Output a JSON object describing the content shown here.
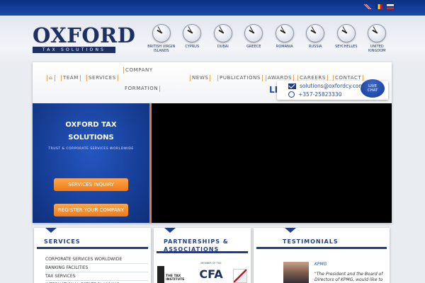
{
  "brand": {
    "name": "OXFORD",
    "tagline": "TAX SOLUTIONS"
  },
  "languages": [
    {
      "flag": "uk-flag-icon"
    },
    {
      "flag": "romania-flag-icon"
    },
    {
      "flag": "russia-flag-icon"
    }
  ],
  "clocks": [
    {
      "label": "British Virgin Islands",
      "hour_angle": 300,
      "minute_angle": 330
    },
    {
      "label": "Cyprus",
      "hour_angle": 300,
      "minute_angle": 330
    },
    {
      "label": "Dubai",
      "hour_angle": 300,
      "minute_angle": 330
    },
    {
      "label": "Greece",
      "hour_angle": 300,
      "minute_angle": 330
    },
    {
      "label": "Romania",
      "hour_angle": 300,
      "minute_angle": 330
    },
    {
      "label": "Russia",
      "hour_angle": 300,
      "minute_angle": 330
    },
    {
      "label": "Seychelles",
      "hour_angle": 300,
      "minute_angle": 330
    },
    {
      "label": "United Kingdom",
      "hour_angle": 300,
      "minute_angle": 330
    }
  ],
  "nav": {
    "home": "⌂",
    "team": "Team",
    "services": "Services",
    "company_formation_line1": "Company",
    "company_formation_line2": "Formation",
    "news": "News",
    "publications": "Publications",
    "awards": "Awards",
    "careers": "Careers",
    "contact": "Contact"
  },
  "partial_title": "LI",
  "contact": {
    "email": "solutions@oxfordcy.com",
    "phone": "+357-25823330",
    "live_chat_line1": "LIVE",
    "live_chat_line2": "CHAT"
  },
  "hero": {
    "title_line1": "OXFORD TAX",
    "title_line2": "SOLUTIONS",
    "subtitle": "TRUST & CORPORATE SERVICES WORLDWIDE",
    "btn_inquiry": "SERVICES INQUIRY",
    "btn_register": "REGISTER YOUR COMPANY"
  },
  "boxes": {
    "services": {
      "title": "Services",
      "items": [
        "Corporate Services Worldwide",
        "Banking Facilities",
        "Tax Services",
        "International Estate Planning"
      ]
    },
    "partnerships": {
      "title_line1": "Partnerships &",
      "title_line2": "Associations",
      "logo1_text": "THE TAX INSTITUTE",
      "logo2_text": "MEMBER OF THE",
      "logo2_big": "CFA"
    },
    "testimonials": {
      "title": "Testimonials",
      "name": "KPMG",
      "quote": "\"The President and the Board of Directors of KPMG, would like to"
    }
  },
  "colors": {
    "brand_navy": "#1d2f63",
    "accent_orange": "#f07a16",
    "link_blue": "#2b4a9a"
  }
}
